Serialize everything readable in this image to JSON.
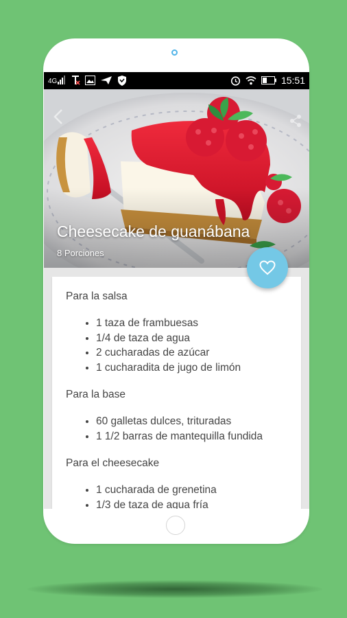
{
  "status_bar": {
    "time": "15:51",
    "left_icons": [
      "signal-bars-icon",
      "network-cross-icon",
      "image-icon",
      "send-icon",
      "shield-icon"
    ],
    "right_icons": [
      "alarm-icon",
      "wifi-icon",
      "battery-icon"
    ]
  },
  "recipe": {
    "title": "Cheesecake de guanábana",
    "servings": "8 Porciones",
    "sections": [
      {
        "heading": "Para la salsa",
        "items": [
          "1 taza de frambuesas",
          "1/4 de taza de agua",
          "2 cucharadas de azúcar",
          "1 cucharadita de jugo de limón"
        ]
      },
      {
        "heading": "Para la base",
        "items": [
          "60 galletas dulces, trituradas",
          "1 1/2 barras de mantequilla fundida"
        ]
      },
      {
        "heading": "Para el cheesecake",
        "items": [
          "1 cucharada de grenetina",
          "1/3 de taza de agua fría"
        ]
      }
    ]
  },
  "actions": {
    "favorite_icon": "heart-icon",
    "share_icon": "share-icon",
    "back_icon": "back-arrow-icon"
  },
  "colors": {
    "background": "#6fc374",
    "fab": "#74c8e6",
    "sauce": "#d8102a"
  }
}
